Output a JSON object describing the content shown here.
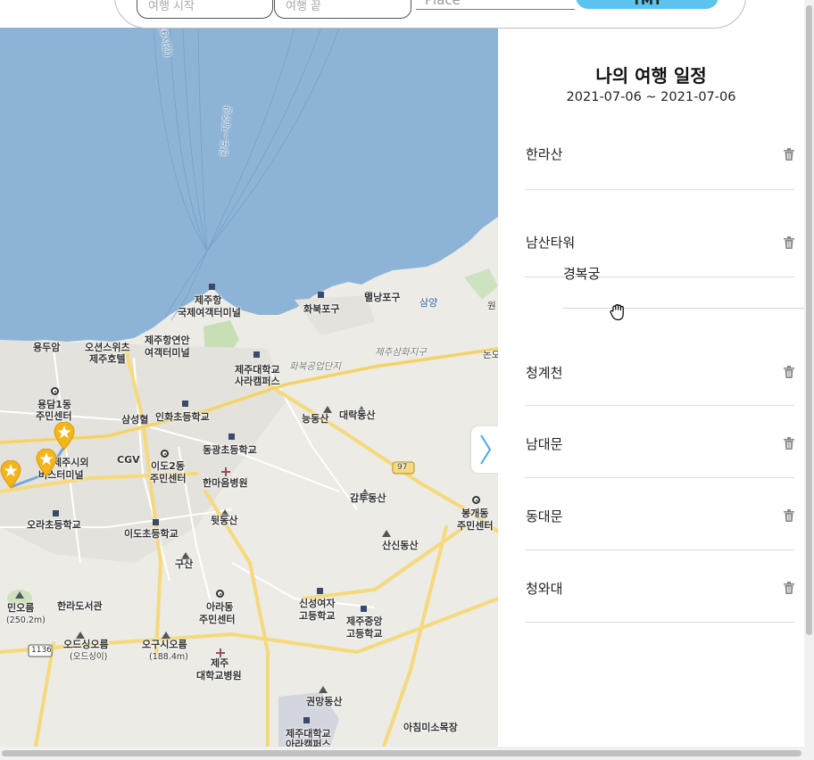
{
  "search_bar": {
    "start_date_placeholder": "여행 시작",
    "end_date_placeholder": "여행 끝",
    "place_placeholder": "Place",
    "submit_label": "TMT"
  },
  "panel": {
    "title": "나의 여행 일정",
    "date_range": "2021-07-06 ~ 2021-07-06",
    "items": [
      {
        "label": "한라산"
      },
      {
        "label": "남산타워"
      },
      {
        "label": "청계천"
      },
      {
        "label": "남대문"
      },
      {
        "label": "동대문"
      },
      {
        "label": "청와대"
      }
    ],
    "dragging_item": {
      "label": "경복궁"
    }
  },
  "map": {
    "labels": {
      "route_a": "(6시간)",
      "route_b": "완도~제주간",
      "jeju_port": "제주항",
      "intl_terminal": "국제여객터미널",
      "hwabuk_port": "화북포구",
      "byeollang_port": "별낭포구",
      "samyang": "삼양",
      "yongduam": "용두암",
      "oriental_hotel_1": "오션스위츠",
      "oriental_hotel_2": "제주호텔",
      "coastal_terminal_1": "제주항연안",
      "coastal_terminal_2": "여객터미널",
      "univ_campus_1": "제주대학교",
      "univ_campus_2": "사라캠퍼스",
      "hwabuk_industrial": "화북공업단지",
      "samhwa_district": "제주삼화지구",
      "yongdam_center_1": "용담1동",
      "yongdam_center_2": "주민센터",
      "samsunghyeol": "삼성혈",
      "inhwa_school": "인화초등학교",
      "neungdongsan": "능동산",
      "daerakdongsan": "대락동산",
      "cgv": "CGV",
      "donggwang_school": "동광초등학교",
      "bus_terminal_1": "제주시외",
      "bus_terminal_2": "버스터미널",
      "ido2_center_1": "이도2동",
      "ido2_center_2": "주민센터",
      "hanmaeum_hospital": "한마음병원",
      "gamtudongsan": "감투동산",
      "bonggae_center_1": "봉개동",
      "bonggae_center_2": "주민센터",
      "route_97": "97",
      "ora_school": "오라초등학교",
      "ido_school": "이도초등학교",
      "dwitdongsan": "뒷동산",
      "sansindongsan": "산신동산",
      "gusan": "구산",
      "minoreum_1": "민오름",
      "minoreum_2": "(250.2m)",
      "halla_library": "한라도서관",
      "ara_center_1": "아라동",
      "ara_center_2": "주민센터",
      "sinseong_school_1": "신성여자",
      "sinseong_school_2": "고등학교",
      "jejujungang_school_1": "제주중앙",
      "jejujungang_school_2": "고등학교",
      "route_1136": "1136",
      "odeusi_1": "오드싱오름",
      "odeusi_2": "(오드싱이)",
      "ogusi_1": "오구시오름",
      "ogusi_2": "(188.4m)",
      "univ_hospital_1": "제주",
      "univ_hospital_2": "대학교병원",
      "gwonmangdongsan": "권망동산",
      "jeju_univ_ara_1": "제주대학교",
      "jeju_univ_ara_2": "아라캠퍼스",
      "achimmiso_farm": "아침미소목장",
      "nondong": "논오",
      "hwabuk_edge": "원"
    },
    "colors": {
      "sea": "#8db4d6",
      "land": "#ecebe6",
      "road_major": "#f5d97a",
      "marker": "#f3b51b"
    }
  }
}
